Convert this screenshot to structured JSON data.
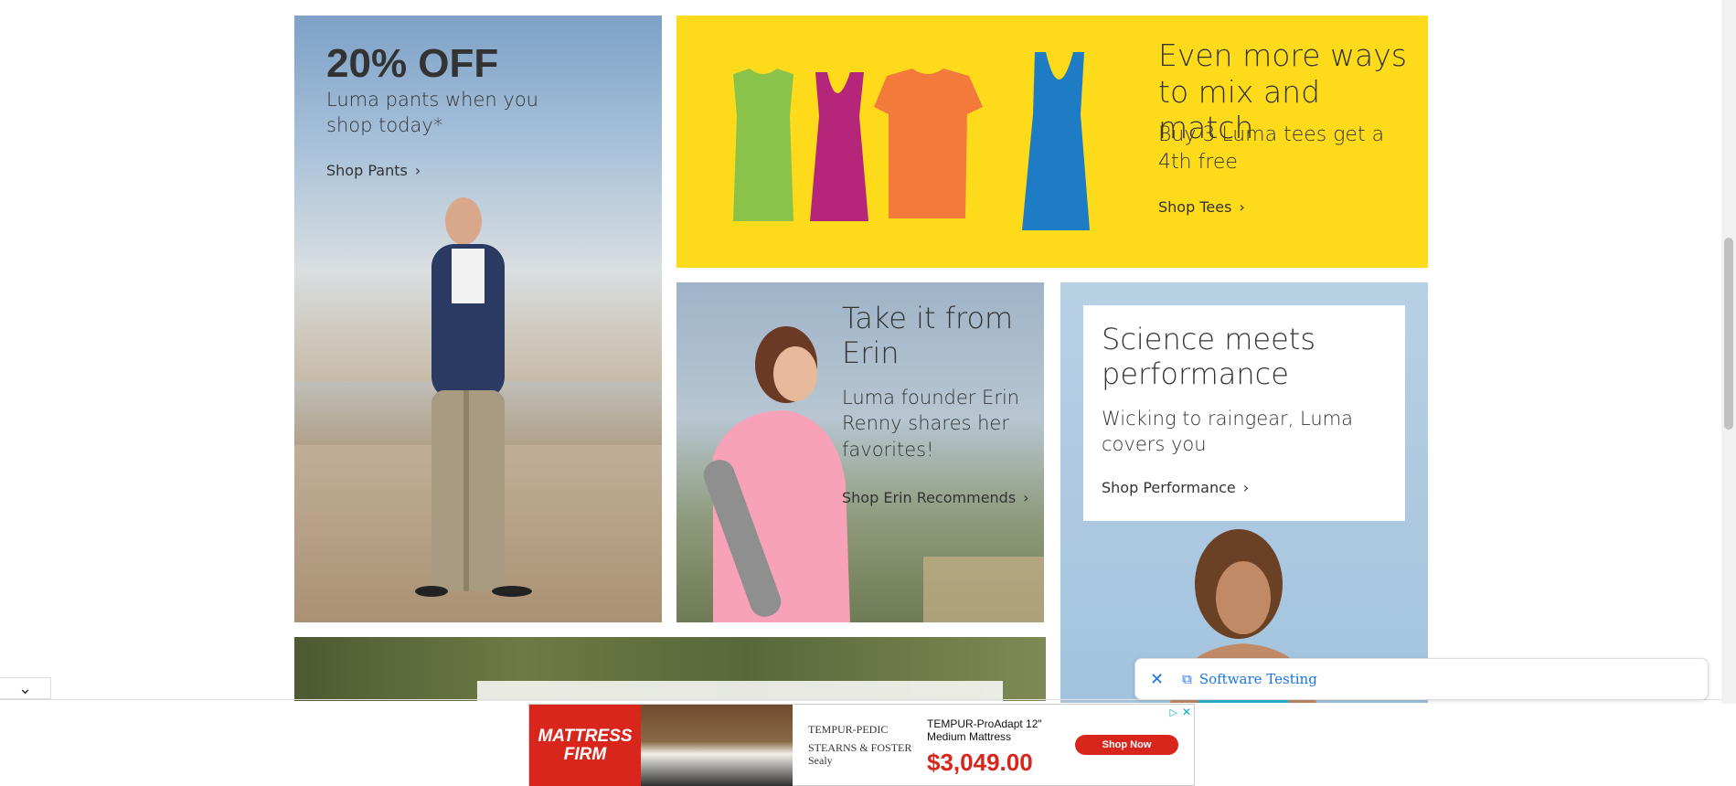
{
  "tiles": {
    "pants": {
      "headline": "20% OFF",
      "subtitle": "Luma pants when you shop today*",
      "link": "Shop Pants"
    },
    "tees": {
      "title": "Even more ways to mix and match",
      "subtitle": "Buy 3 Luma tees get a 4th free",
      "link": "Shop Tees",
      "shirt_colors": [
        "#8bc34a",
        "#b5267a",
        "#f47a3c",
        "#1e7cc4"
      ]
    },
    "erin": {
      "title": "Take it from Erin",
      "subtitle": "Luma founder Erin Renny shares her favorites!",
      "link": "Shop Erin Recommends"
    },
    "performance": {
      "title": "Science meets performance",
      "subtitle": "Wicking to raingear, Luma covers you",
      "link": "Shop Performance"
    }
  },
  "icons": {
    "chevron": "›",
    "collapse": "⌄",
    "close": "✕",
    "translate": "⧉"
  },
  "translate_bar": {
    "label": "Software Testing"
  },
  "ad": {
    "brand": "MATTRESS FIRM",
    "partner_brands": [
      "TEMPUR-PEDIC",
      "STEARNS & FOSTER",
      "Sealy"
    ],
    "product": "TEMPUR-ProAdapt 12\" Medium Mattress",
    "price": "$3,049.00",
    "cta": "Shop Now",
    "adchoices": "▷",
    "close": "✕"
  },
  "colors": {
    "tees_bg": "#fddb1b",
    "ad_red": "#d9261c",
    "link_blue": "#1a73e8"
  }
}
